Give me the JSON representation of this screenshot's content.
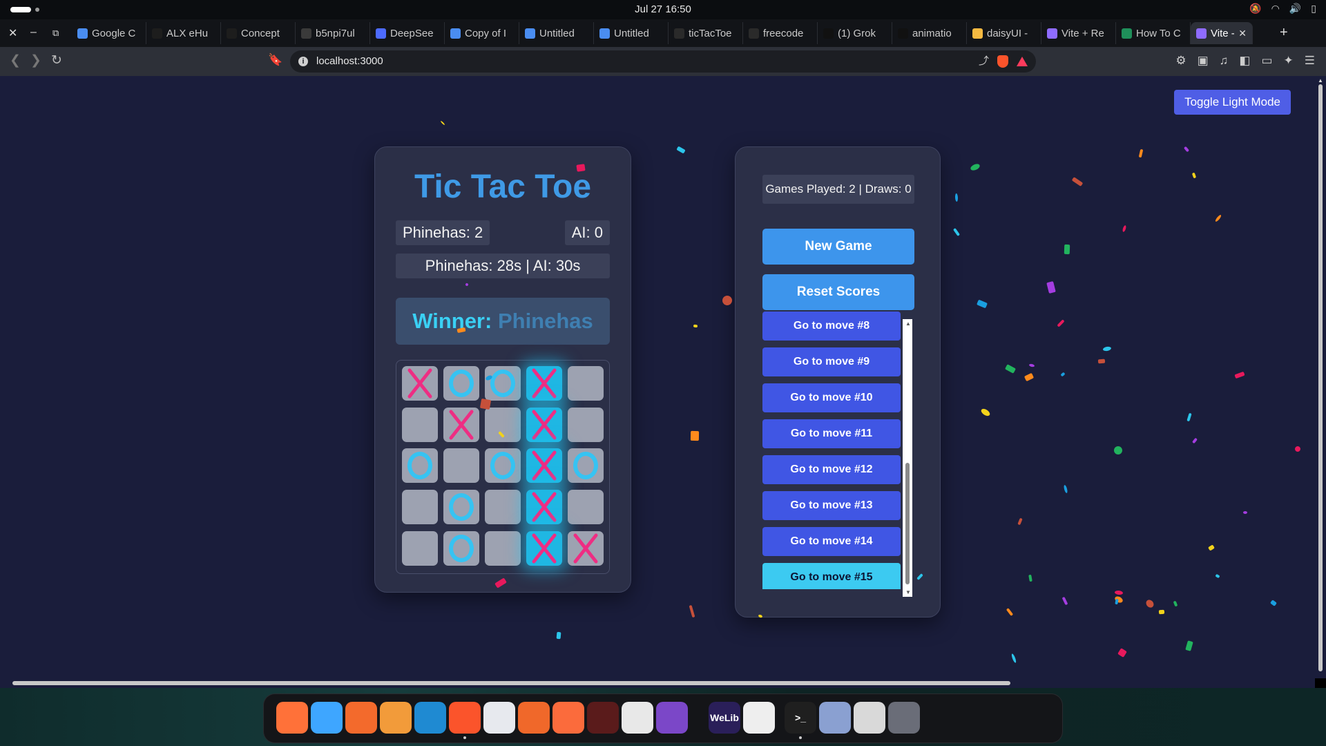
{
  "system": {
    "clock": "Jul 27  16:50"
  },
  "tabs": [
    {
      "label": "Google C",
      "favicon": "gemini-icon",
      "color": "#4a8df0"
    },
    {
      "label": "ALX eHu",
      "favicon": "alx-icon",
      "color": "#1d1d1d"
    },
    {
      "label": "Concept",
      "favicon": "concept-icon",
      "color": "#1d1d1d"
    },
    {
      "label": "b5npi7ul",
      "favicon": "openai-icon",
      "color": "#3a3a3a"
    },
    {
      "label": "DeepSee",
      "favicon": "deepseek-icon",
      "color": "#4d6bfe"
    },
    {
      "label": "Copy of I",
      "favicon": "docs-icon",
      "color": "#4a8df0"
    },
    {
      "label": "Untitled",
      "favicon": "docs-icon",
      "color": "#4a8df0"
    },
    {
      "label": "Untitled",
      "favicon": "docs-icon",
      "color": "#4a8df0"
    },
    {
      "label": "ticTacToe",
      "favicon": "github-icon",
      "color": "#2a2a2a"
    },
    {
      "label": "freecode",
      "favicon": "freecodecamp-icon",
      "color": "#2a2a2a"
    },
    {
      "label": "(1) Grok",
      "favicon": "x-icon",
      "color": "#111"
    },
    {
      "label": "animatio",
      "favicon": "medium-icon",
      "color": "#111"
    },
    {
      "label": "daisyUI -",
      "favicon": "daisyui-icon",
      "color": "#f5b941"
    },
    {
      "label": "Vite + Re",
      "favicon": "vite-icon",
      "color": "#8f6cff"
    },
    {
      "label": "How To C",
      "favicon": "w-icon",
      "color": "#1f8f5a"
    },
    {
      "label": "Vite -",
      "favicon": "vite-icon",
      "color": "#8f6cff",
      "active": true
    }
  ],
  "address": {
    "url": "localhost:3000"
  },
  "page": {
    "toggle_label": "Toggle Light Mode",
    "title": "Tic Tac Toe",
    "score_player": "Phinehas: 2",
    "score_ai": "AI: 0",
    "timer": "Phinehas: 28s | AI: 30s",
    "winner_prefix": "Winner:",
    "winner_name": "Phinehas",
    "stats": "Games Played: 2 | Draws: 0",
    "new_game": "New Game",
    "reset_scores": "Reset Scores",
    "moves": [
      "Go to move #8",
      "Go to move #9",
      "Go to move #10",
      "Go to move #11",
      "Go to move #12",
      "Go to move #13",
      "Go to move #14",
      "Go to move #15"
    ],
    "current_move": "Go to move #15"
  },
  "board": {
    "cells": [
      [
        "X",
        "O",
        "O",
        "X",
        ""
      ],
      [
        "",
        "X",
        "",
        "X",
        ""
      ],
      [
        "O",
        "",
        "O",
        "X",
        "O"
      ],
      [
        "",
        "O",
        "",
        "X",
        ""
      ],
      [
        "",
        "O",
        "",
        "X",
        "X"
      ]
    ],
    "winning_column": 3
  },
  "dock": [
    {
      "name": "firefox-icon",
      "color": "#ff7139"
    },
    {
      "name": "finder-icon",
      "color": "#3ea6ff"
    },
    {
      "name": "app-store-icon",
      "color": "#f36a2c"
    },
    {
      "name": "photo-app-icon",
      "color": "#f29b3a"
    },
    {
      "name": "vscode-icon",
      "color": "#1f8ad2"
    },
    {
      "name": "brave-icon",
      "color": "#fb542b"
    },
    {
      "name": "notes-icon",
      "color": "#e7e9ee"
    },
    {
      "name": "share-app-icon",
      "color": "#f0682a"
    },
    {
      "name": "pencil-app-icon",
      "color": "#fb6b3c"
    },
    {
      "name": "time-machine-icon",
      "color": "#5a1b1b"
    },
    {
      "name": "chrome-icon",
      "color": "#e8e8e8"
    },
    {
      "name": "github-desktop-icon",
      "color": "#7b47c8"
    },
    {
      "name": "welib-icon",
      "color": "#2a1f59",
      "label": "WeLib"
    },
    {
      "name": "app-squirrel-icon",
      "color": "#eeeeee"
    },
    {
      "name": "terminal-icon",
      "color": "#1f1f1f",
      "label": ">_"
    },
    {
      "name": "disk-utility-icon",
      "color": "#8aa0d1"
    },
    {
      "name": "trash-icon",
      "color": "#d9d9d9"
    },
    {
      "name": "app-grid-icon",
      "color": "#6a6d78"
    }
  ]
}
